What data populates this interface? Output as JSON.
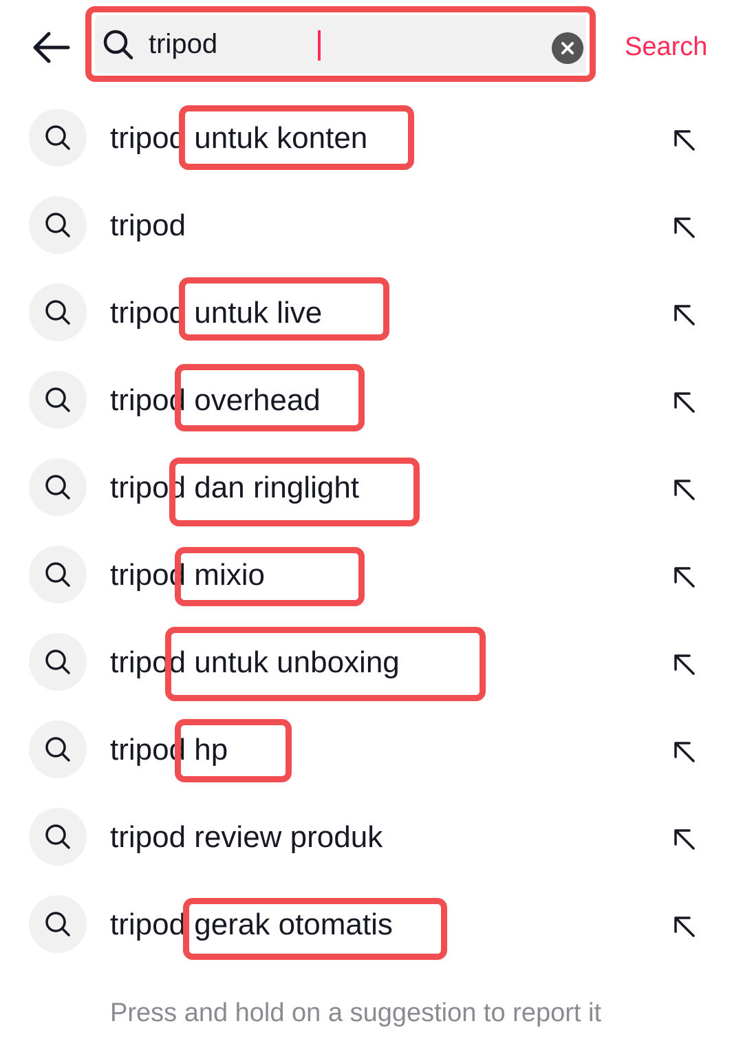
{
  "search": {
    "query": "tripod",
    "action_label": "Search"
  },
  "suggestions": [
    {
      "base": "tripod",
      "rest": " untuk konten",
      "highlighted": true
    },
    {
      "base": "tripod",
      "rest": "",
      "highlighted": false
    },
    {
      "base": "tripod",
      "rest": " untuk live",
      "highlighted": true
    },
    {
      "base": "tripod",
      "rest": " overhead",
      "highlighted": true
    },
    {
      "base": "tripod",
      "rest": " dan ringlight",
      "highlighted": true
    },
    {
      "base": "tripod",
      "rest": " mixio",
      "highlighted": true
    },
    {
      "base": "tripod",
      "rest": " untuk unboxing",
      "highlighted": true
    },
    {
      "base": "tripod",
      "rest": " hp",
      "highlighted": true
    },
    {
      "base": "tripod",
      "rest": " review produk",
      "highlighted": false
    },
    {
      "base": "tripod",
      "rest": " gerak otomatis",
      "highlighted": true
    }
  ],
  "footer": {
    "hint": "Press and hold on a suggestion to report it"
  },
  "colors": {
    "accent": "#fe2c55",
    "highlight_box": "#f04e51",
    "icon_bg": "#f1f1f2",
    "hint_text": "#8a8b91"
  },
  "icons": {
    "back": "arrow-left-icon",
    "search": "search-icon",
    "clear": "clear-x-icon",
    "fill": "arrow-up-left-icon"
  }
}
